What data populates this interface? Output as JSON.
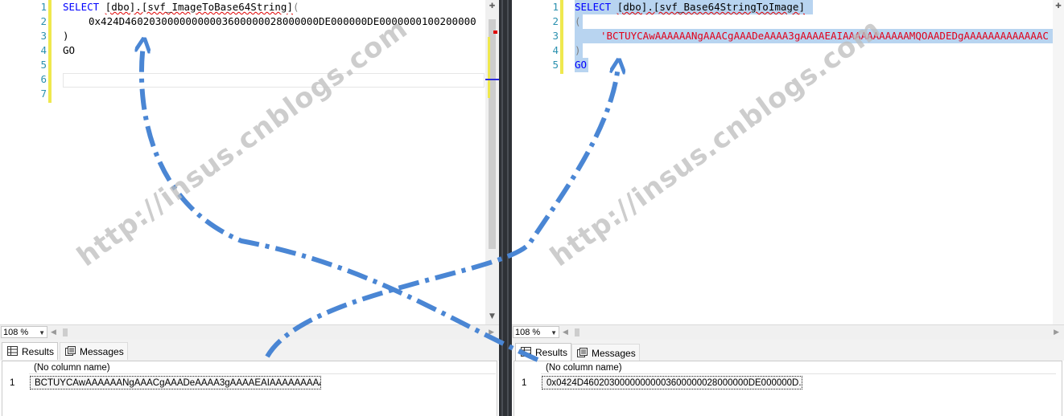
{
  "left": {
    "line_numbers": [
      "1",
      "2",
      "3",
      "4",
      "5",
      "6",
      "7"
    ],
    "code": {
      "line1_kw": "SELECT",
      "line1_obj": "[dbo].[svf_ImageToBase64String]",
      "line1_paren": "(",
      "line2": "0x424D46020300000000003600000028000000DE000000DE0000000100200000",
      "line3": ")",
      "line4": "GO"
    },
    "zoom": "108 %",
    "tabs": {
      "results": "Results",
      "messages": "Messages"
    },
    "grid": {
      "column_header": "(No column name)",
      "row_number": "1",
      "value": "BCTUYCAwAAAAAANgAAACgAAADeAAAA3gAAAAEAIAAAAAAAAAAA..."
    }
  },
  "right": {
    "line_numbers": [
      "1",
      "2",
      "3",
      "4",
      "5"
    ],
    "code": {
      "line1_kw": "SELECT",
      "line1_obj": "[dbo].[svf_Base64StringToImage]",
      "line2": "(",
      "line3": "'BCTUYCAwAAAAAANgAAACgAAADeAAAA3gAAAAEAIAAAAAAAAAAAMQOAADEDgAAAAAAAAAAAAAC",
      "line4": ")",
      "line5": "GO"
    },
    "zoom": "108 %",
    "tabs": {
      "results": "Results",
      "messages": "Messages"
    },
    "grid": {
      "column_header": "(No column name)",
      "row_number": "1",
      "value": "0x0424D46020300000000003600000028000000DE000000D..."
    }
  },
  "watermark": "http://insus.cnblogs.com",
  "colors": {
    "keyword": "#0000ff",
    "string": "#e1001a",
    "line_number": "#2b91af",
    "selection": "#b8d4f0",
    "change_marker": "#efe84e",
    "arrow": "#4a86d4",
    "divider": "#2e3136"
  }
}
